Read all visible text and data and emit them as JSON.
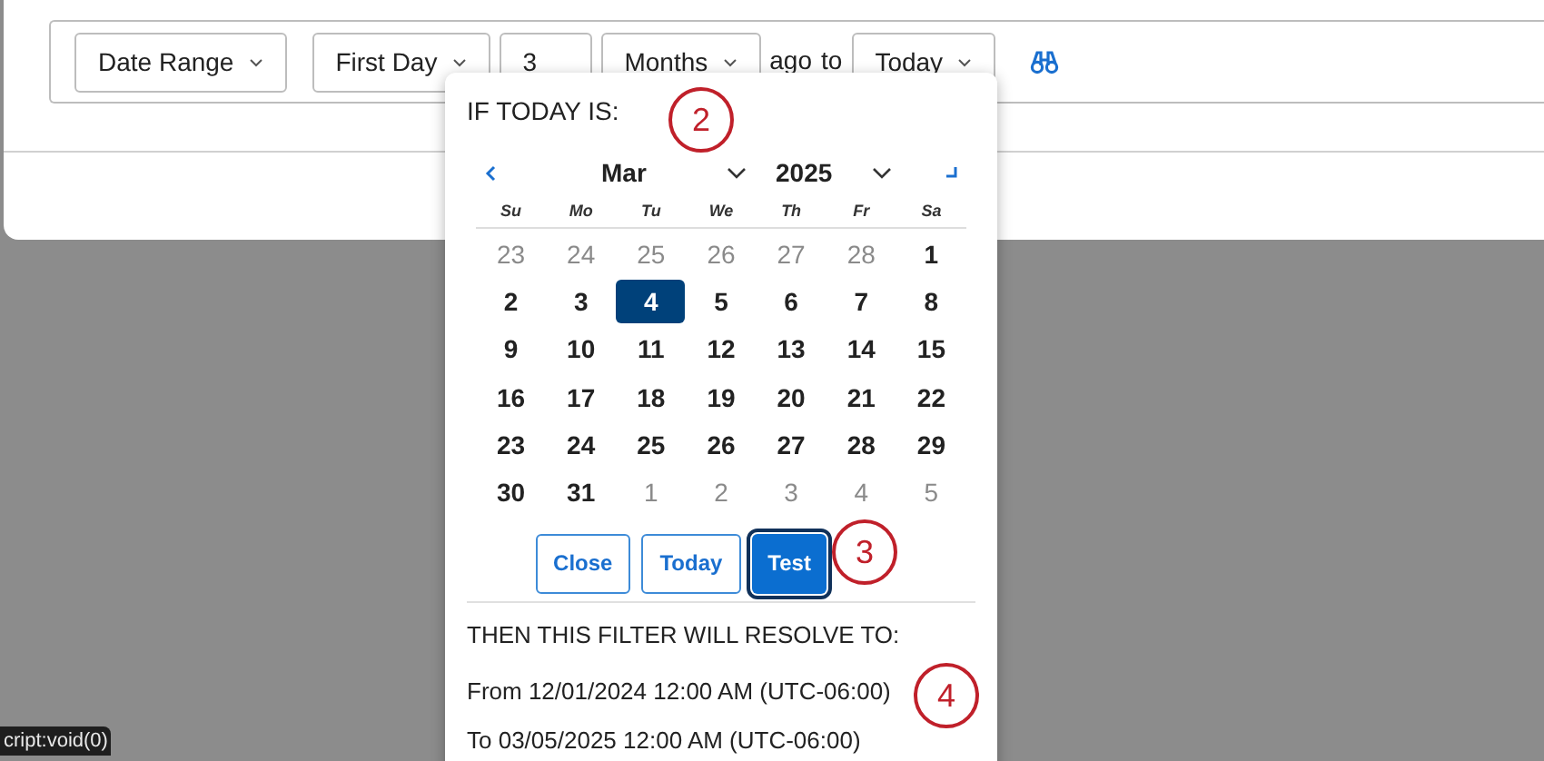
{
  "filter": {
    "items": [
      {
        "kind": "dropdown",
        "value": "Date Range"
      },
      {
        "kind": "dropdown",
        "value": "First Day"
      },
      {
        "kind": "input",
        "value": "3"
      },
      {
        "kind": "dropdown",
        "value": "Months"
      },
      {
        "kind": "text",
        "value": "ago"
      },
      {
        "kind": "text",
        "value": "to"
      },
      {
        "kind": "dropdown",
        "value": "Today"
      }
    ]
  },
  "popup": {
    "heading": "IF TODAY IS:",
    "month": "Mar",
    "year": "2025",
    "weekdays": [
      "Su",
      "Mo",
      "Tu",
      "We",
      "Th",
      "Fr",
      "Sa"
    ],
    "weeks": [
      [
        {
          "day": "23",
          "muted": true,
          "selected": false
        },
        {
          "day": "24",
          "muted": true,
          "selected": false
        },
        {
          "day": "25",
          "muted": true,
          "selected": false
        },
        {
          "day": "26",
          "muted": true,
          "selected": false
        },
        {
          "day": "27",
          "muted": true,
          "selected": false
        },
        {
          "day": "28",
          "muted": true,
          "selected": false
        },
        {
          "day": "1",
          "muted": false,
          "selected": false
        }
      ],
      [
        {
          "day": "2",
          "muted": false,
          "selected": false
        },
        {
          "day": "3",
          "muted": false,
          "selected": false
        },
        {
          "day": "4",
          "muted": false,
          "selected": true
        },
        {
          "day": "5",
          "muted": false,
          "selected": false
        },
        {
          "day": "6",
          "muted": false,
          "selected": false
        },
        {
          "day": "7",
          "muted": false,
          "selected": false
        },
        {
          "day": "8",
          "muted": false,
          "selected": false
        }
      ],
      [
        {
          "day": "9",
          "muted": false,
          "selected": false
        },
        {
          "day": "10",
          "muted": false,
          "selected": false
        },
        {
          "day": "11",
          "muted": false,
          "selected": false
        },
        {
          "day": "12",
          "muted": false,
          "selected": false
        },
        {
          "day": "13",
          "muted": false,
          "selected": false
        },
        {
          "day": "14",
          "muted": false,
          "selected": false
        },
        {
          "day": "15",
          "muted": false,
          "selected": false
        }
      ],
      [
        {
          "day": "16",
          "muted": false,
          "selected": false
        },
        {
          "day": "17",
          "muted": false,
          "selected": false
        },
        {
          "day": "18",
          "muted": false,
          "selected": false
        },
        {
          "day": "19",
          "muted": false,
          "selected": false
        },
        {
          "day": "20",
          "muted": false,
          "selected": false
        },
        {
          "day": "21",
          "muted": false,
          "selected": false
        },
        {
          "day": "22",
          "muted": false,
          "selected": false
        }
      ],
      [
        {
          "day": "23",
          "muted": false,
          "selected": false
        },
        {
          "day": "24",
          "muted": false,
          "selected": false
        },
        {
          "day": "25",
          "muted": false,
          "selected": false
        },
        {
          "day": "26",
          "muted": false,
          "selected": false
        },
        {
          "day": "27",
          "muted": false,
          "selected": false
        },
        {
          "day": "28",
          "muted": false,
          "selected": false
        },
        {
          "day": "29",
          "muted": false,
          "selected": false
        }
      ],
      [
        {
          "day": "30",
          "muted": false,
          "selected": false
        },
        {
          "day": "31",
          "muted": false,
          "selected": false
        },
        {
          "day": "1",
          "muted": true,
          "selected": false
        },
        {
          "day": "2",
          "muted": true,
          "selected": false
        },
        {
          "day": "3",
          "muted": true,
          "selected": false
        },
        {
          "day": "4",
          "muted": true,
          "selected": false
        },
        {
          "day": "5",
          "muted": true,
          "selected": false
        }
      ]
    ],
    "buttons": [
      {
        "label": "Close",
        "kind": "outline"
      },
      {
        "label": "Today",
        "kind": "outline"
      },
      {
        "label": "Test",
        "kind": "primary"
      }
    ],
    "result_heading": "THEN THIS FILTER WILL RESOLVE TO:",
    "result_lines": [
      "From 12/01/2024 12:00 AM (UTC-06:00)",
      "To 03/05/2025 12:00 AM (UTC-06:00)"
    ]
  },
  "callouts": [
    "2",
    "3",
    "4"
  ],
  "status_bar": "cript:void(0)"
}
